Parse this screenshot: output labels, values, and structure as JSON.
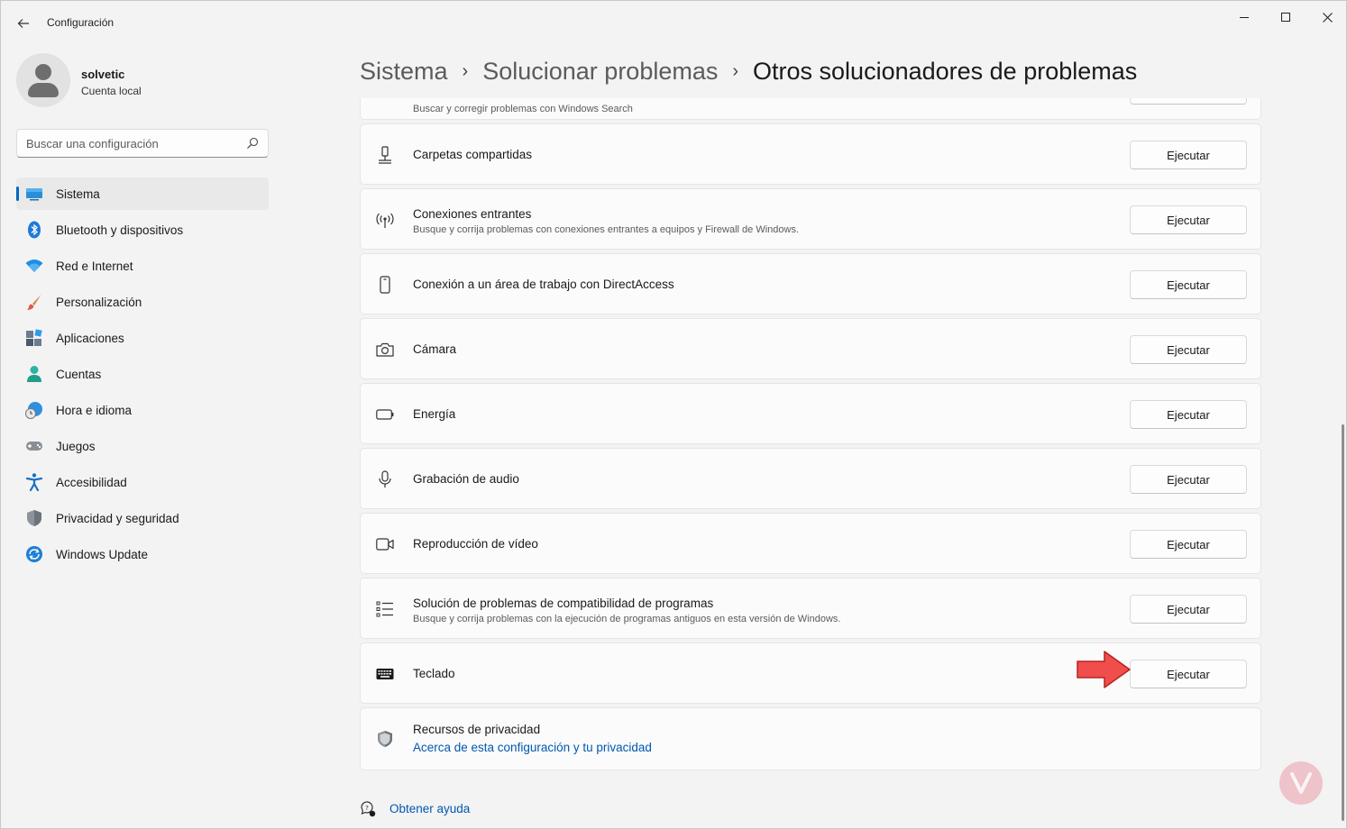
{
  "window": {
    "title": "Configuración",
    "controls": {
      "minimize": "minimize-icon",
      "maximize": "maximize-icon",
      "close": "close-icon"
    }
  },
  "profile": {
    "name": "solvetic",
    "account_type": "Cuenta local"
  },
  "search": {
    "placeholder": "Buscar una configuración"
  },
  "sidebar": {
    "items": [
      {
        "label": "Sistema",
        "icon": "system-icon",
        "active": true
      },
      {
        "label": "Bluetooth y dispositivos",
        "icon": "bluetooth-icon"
      },
      {
        "label": "Red e Internet",
        "icon": "wifi-icon"
      },
      {
        "label": "Personalización",
        "icon": "brush-icon"
      },
      {
        "label": "Aplicaciones",
        "icon": "apps-icon"
      },
      {
        "label": "Cuentas",
        "icon": "account-icon"
      },
      {
        "label": "Hora e idioma",
        "icon": "clock-globe-icon"
      },
      {
        "label": "Juegos",
        "icon": "gamepad-icon"
      },
      {
        "label": "Accesibilidad",
        "icon": "accessibility-icon"
      },
      {
        "label": "Privacidad y seguridad",
        "icon": "shield-icon"
      },
      {
        "label": "Windows Update",
        "icon": "update-icon"
      }
    ]
  },
  "breadcrumb": {
    "items": [
      "Sistema",
      "Solucionar problemas"
    ],
    "current": "Otros solucionadores de problemas"
  },
  "troubleshooters": {
    "partial_top": {
      "desc": "Buscar y corregir problemas con Windows Search"
    },
    "items": [
      {
        "title": "Carpetas compartidas",
        "desc": "",
        "button": "Ejecutar",
        "icon": "shared-folder-icon"
      },
      {
        "title": "Conexiones entrantes",
        "desc": "Busque y corrija problemas con conexiones entrantes a equipos y Firewall de Windows.",
        "button": "Ejecutar",
        "icon": "broadcast-icon"
      },
      {
        "title": "Conexión a un área de trabajo con DirectAccess",
        "desc": "",
        "button": "Ejecutar",
        "icon": "phone-device-icon"
      },
      {
        "title": "Cámara",
        "desc": "",
        "button": "Ejecutar",
        "icon": "camera-icon"
      },
      {
        "title": "Energía",
        "desc": "",
        "button": "Ejecutar",
        "icon": "battery-icon"
      },
      {
        "title": "Grabación de audio",
        "desc": "",
        "button": "Ejecutar",
        "icon": "microphone-icon"
      },
      {
        "title": "Reproducción de vídeo",
        "desc": "",
        "button": "Ejecutar",
        "icon": "video-icon"
      },
      {
        "title": "Solución de problemas de compatibilidad de programas",
        "desc": "Busque y corrija problemas con la ejecución de programas antiguos en esta versión de Windows.",
        "button": "Ejecutar",
        "icon": "list-icon"
      },
      {
        "title": "Teclado",
        "desc": "",
        "button": "Ejecutar",
        "icon": "keyboard-icon"
      }
    ]
  },
  "privacy": {
    "title": "Recursos de privacidad",
    "link": "Acerca de esta configuración y tu privacidad"
  },
  "help": {
    "label": "Obtener ayuda"
  },
  "annotation": {
    "arrow_color": "#f04d4d"
  },
  "colors": {
    "accent": "#0067c0",
    "link": "#0058b0"
  }
}
